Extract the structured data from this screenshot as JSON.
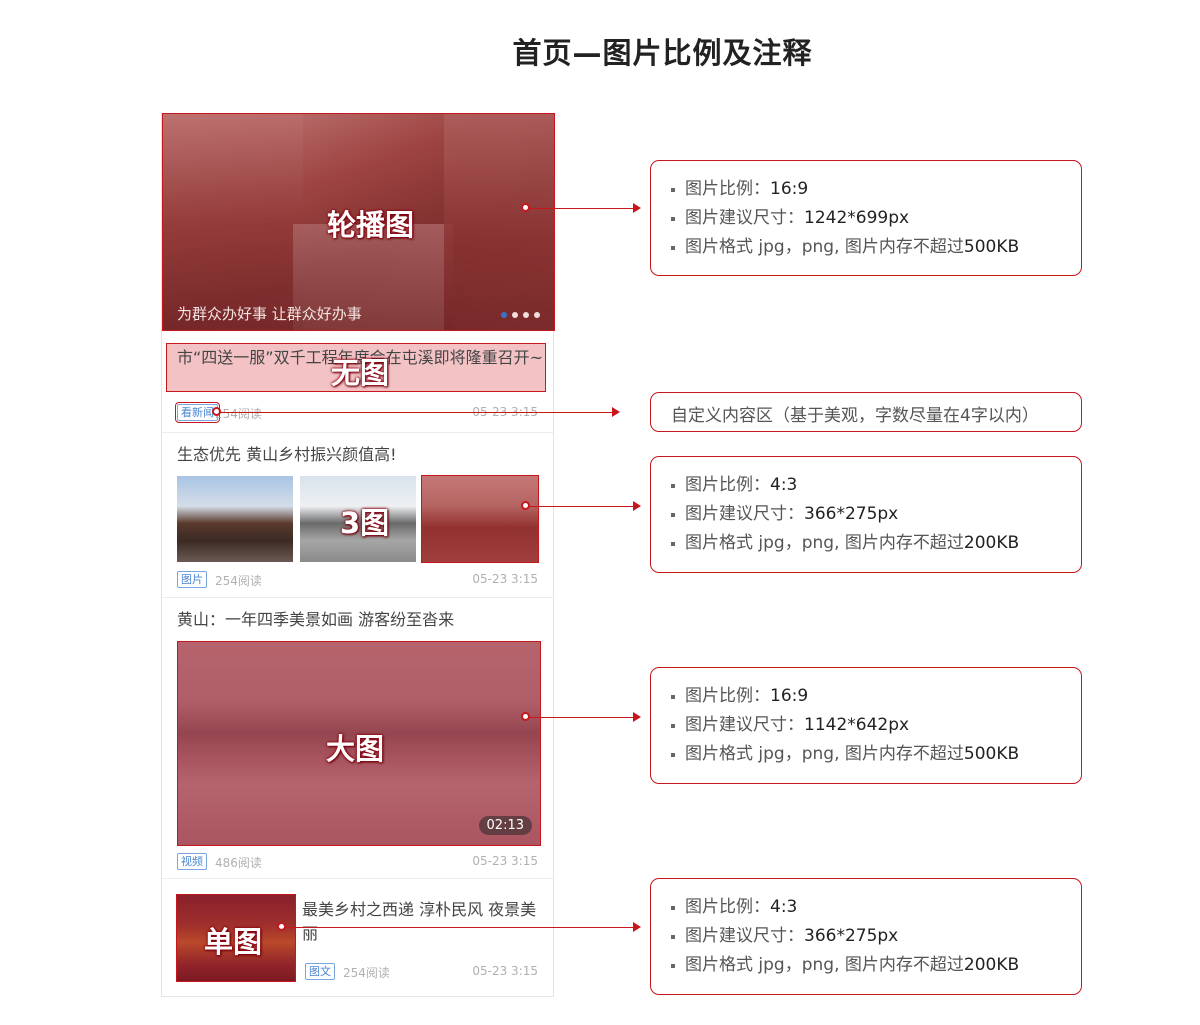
{
  "page_title": "首页—图片比例及注释",
  "carousel": {
    "caption": "为群众办好事 让群众好办事",
    "overlay_label": "轮播图"
  },
  "articles": [
    {
      "title": "市“四送一服”双千工程年度会在屯溪即将隆重召开~",
      "overlay_label": "无图",
      "tag": "看新闻",
      "reads": "254阅读",
      "time": "05-23 3:15"
    },
    {
      "title": "生态优先 黄山乡村振兴颜值高!",
      "overlay_label": "3图",
      "tag": "图片",
      "reads": "254阅读",
      "time": "05-23 3:15"
    },
    {
      "title": "黄山：一年四季美景如画 游客纷至沓来",
      "overlay_label": "大图",
      "duration": "02:13",
      "tag": "视频",
      "reads": "486阅读",
      "time": "05-23 3:15"
    },
    {
      "title": "最美乡村之西递 淳朴民风 夜景美丽",
      "overlay_label": "单图",
      "tag": "图文",
      "reads": "254阅读",
      "time": "05-23 3:15"
    }
  ],
  "annotations": [
    {
      "ratio_label": "图片比例：",
      "ratio_value": "16:9",
      "size_label": "图片建议尺寸：",
      "size_value": "1242*699px",
      "format_label": "图片格式 jpg，png, 图片内存不超过",
      "format_value": "500KB"
    },
    {
      "custom_text": "自定义内容区（基于美观，字数尽量在4字以内）"
    },
    {
      "ratio_label": "图片比例：",
      "ratio_value": "4:3",
      "size_label": "图片建议尺寸：",
      "size_value": "366*275px",
      "format_label": "图片格式 jpg，png, 图片内存不超过",
      "format_value": "200KB"
    },
    {
      "ratio_label": "图片比例：",
      "ratio_value": "16:9",
      "size_label": "图片建议尺寸：",
      "size_value": "1142*642px",
      "format_label": "图片格式 jpg，png, 图片内存不超过",
      "format_value": "500KB"
    },
    {
      "ratio_label": "图片比例：",
      "ratio_value": "4:3",
      "size_label": "图片建议尺寸：",
      "size_value": "366*275px",
      "format_label": "图片格式 jpg，png, 图片内存不超过",
      "format_value": "200KB"
    }
  ],
  "colors": {
    "accent_red": "#c8161d",
    "tag_blue": "#4a86d4",
    "active_dot_blue": "#3b73c8"
  }
}
